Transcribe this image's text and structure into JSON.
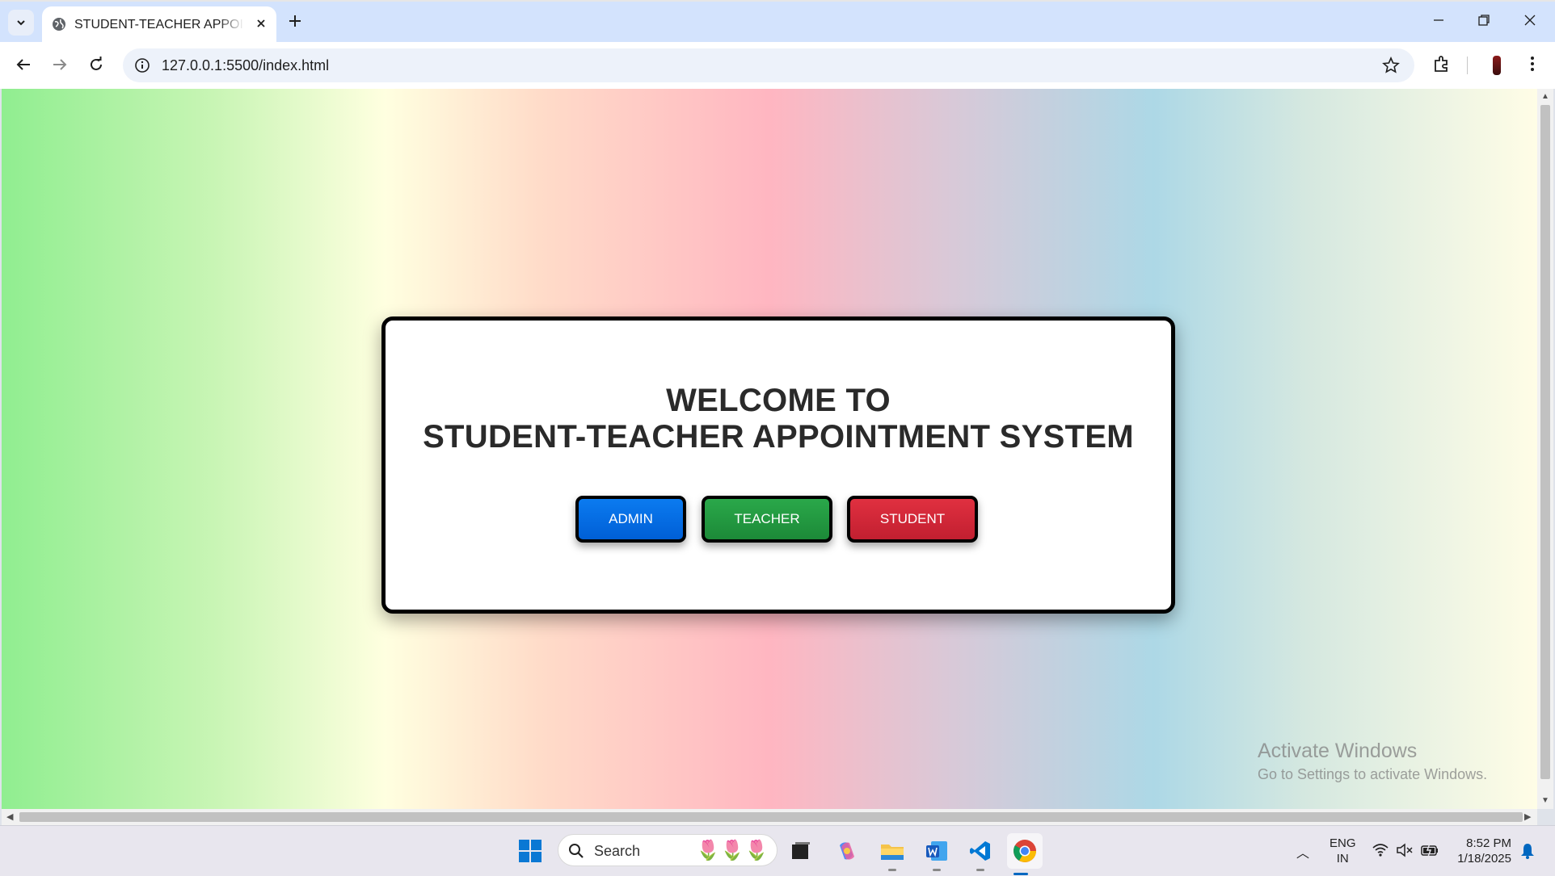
{
  "browser": {
    "tab_title": "STUDENT-TEACHER APPOINTMENT SYSTEM",
    "url": "127.0.0.1:5500/index.html"
  },
  "page": {
    "heading_line1": "WELCOME TO",
    "heading_line2": "STUDENT-TEACHER APPOINTMENT SYSTEM",
    "buttons": {
      "admin": "ADMIN",
      "teacher": "TEACHER",
      "student": "STUDENT"
    },
    "colors": {
      "admin": "#0a6fe6",
      "teacher": "#23983f",
      "student": "#d22a39"
    }
  },
  "watermark": {
    "line1": "Activate Windows",
    "line2": "Go to Settings to activate Windows."
  },
  "taskbar": {
    "search_label": "Search",
    "lang_line1": "ENG",
    "lang_line2": "IN",
    "time": "8:52 PM",
    "date": "1/18/2025",
    "apps": [
      "task-view-icon",
      "copilot-icon",
      "file-explorer-icon",
      "word-icon",
      "vscode-icon",
      "chrome-icon"
    ]
  }
}
